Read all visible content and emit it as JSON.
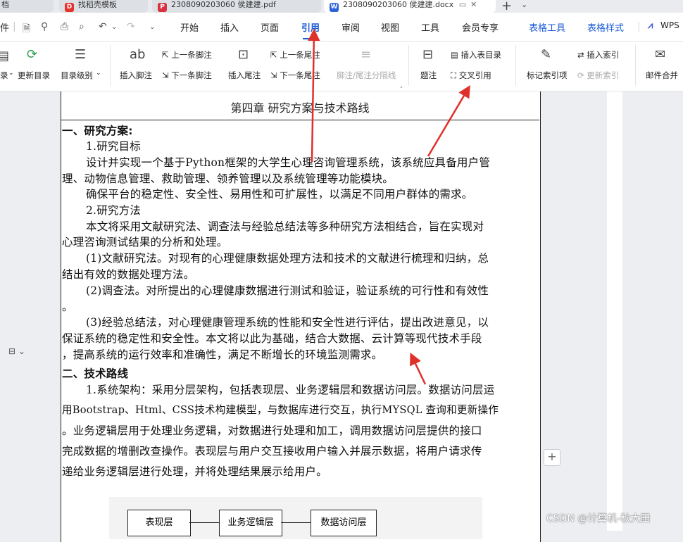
{
  "tabs": [
    {
      "label": "档",
      "kind": "generic"
    },
    {
      "label": "找稻壳模板",
      "kind": "docer"
    },
    {
      "label": "2308090203060 侯建建.pdf",
      "kind": "pdf"
    },
    {
      "label": "2308090203060 侯建建.docx",
      "kind": "word"
    }
  ],
  "newtab_label": "+",
  "menu": {
    "items": [
      "开始",
      "插入",
      "页面",
      "引用",
      "审阅",
      "视图",
      "工具",
      "会员专享"
    ],
    "active": "引用",
    "contextual": [
      "表格工具",
      "表格样式"
    ],
    "wps_label": "WPS",
    "left_cut": "件"
  },
  "ribbon": {
    "update_toc": "更新目录",
    "toc_level": "目录级别",
    "left_cut": "录",
    "insert_footnote": "插入脚注",
    "prev_footnote": "上一条脚注",
    "next_footnote": "下一条脚注",
    "insert_endnote": "插入尾注",
    "prev_endnote": "上一条尾注",
    "next_endnote": "下一条尾注",
    "separator_line": "脚注/尾注分隔线",
    "caption": "题注",
    "insert_toc_table": "插入表目录",
    "cross_reference": "交叉引用",
    "mark_index": "标记索引项",
    "insert_index": "插入索引",
    "update_index": "更新索引",
    "mail_merge": "邮件合并"
  },
  "document": {
    "chapter_title": "第四章  研究方案与技术路线",
    "lines": [
      "一、研究方案:",
      "1.研究目标",
      "设计并实现一个基于Python框架的大学生心理咨询管理系统，该系统应具备用户管",
      "理、动物信息管理、救助管理、领养管理以及系统管理等功能模块。",
      "确保平台的稳定性、安全性、易用性和可扩展性，以满足不同用户群体的需求。",
      "2.研究方法",
      "本文将采用文献研究法、调查法与经验总结法等多种研究方法相结合，旨在实现对",
      "心理咨询测试结果的分析和处理。",
      "(1)文献研究法。对现有的心理健康数据处理方法和技术的文献进行梳理和归纳，总",
      "结出有效的数据处理方法。",
      "(2)调查法。对所提出的心理健康数据进行测试和验证，验证系统的可行性和有效性",
      "。",
      "(3)经验总结法，对心理健康管理系统的性能和安全性进行评估，提出改进意见，以",
      "保证系统的稳定性和安全性。本文将以此为基础，结合大数据、云计算等现代技术手段",
      "，提高系统的运行效率和准确性，满足不断增长的环境监测需求。",
      "二、技术路线",
      "1.系统架构：采用分层架构，包括表现层、业务逻辑层和数据访问层。数据访问层运",
      "用Bootstrap、Html、CSS技术构建模型，与数据库进行交互，执行MYSQL 查询和更新操作",
      "。业务逻辑层用于处理业务逻辑，对数据进行处理和加工，调用数据访问层提供的接口",
      "完成数据的增删改查操作。表现层与用户交互接收用户输入并展示数据，将用户请求传",
      "递给业务逻辑层进行处理，并将处理结果展示给用户。"
    ],
    "diagram_boxes": [
      "表现层",
      "业务逻辑层",
      "数据访问层"
    ]
  },
  "watermark": "CSDN @计算机-秋大田",
  "colors": {
    "accent": "#1a5bd8",
    "arrow": "#e0302a"
  }
}
